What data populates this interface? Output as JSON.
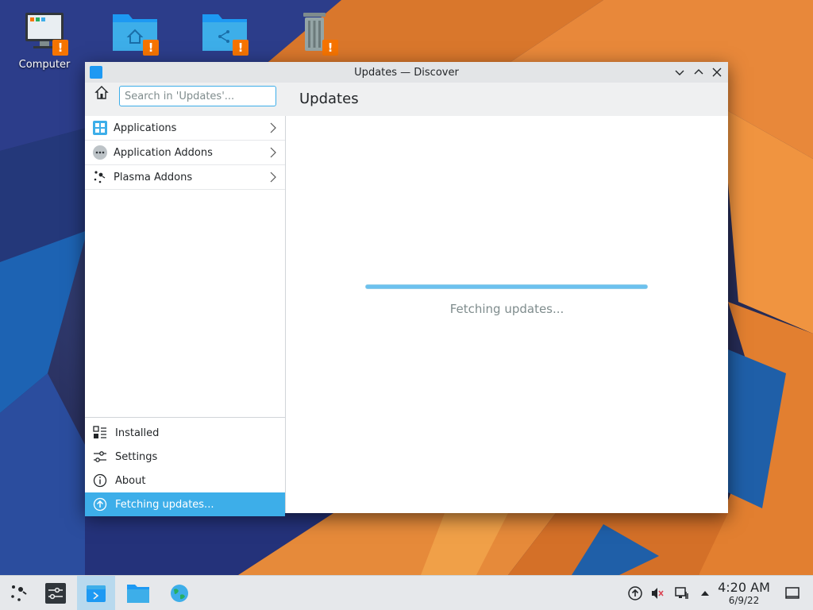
{
  "desktop": {
    "icons": [
      {
        "label": "Computer",
        "icon": "computer-icon"
      },
      {
        "label": "",
        "icon": "home-folder-icon"
      },
      {
        "label": "",
        "icon": "network-folder-icon"
      },
      {
        "label": "",
        "icon": "trash-icon"
      }
    ]
  },
  "window": {
    "title": "Updates — Discover",
    "search_placeholder": "Search in 'Updates'...",
    "page_title": "Updates",
    "categories": [
      {
        "label": "Applications",
        "icon": "applications-icon"
      },
      {
        "label": "Application Addons",
        "icon": "addons-icon"
      },
      {
        "label": "Plasma Addons",
        "icon": "plasma-icon"
      }
    ],
    "nav": [
      {
        "label": "Installed",
        "icon": "installed-icon"
      },
      {
        "label": "Settings",
        "icon": "settings-icon"
      },
      {
        "label": "About",
        "icon": "info-icon"
      },
      {
        "label": "Fetching updates...",
        "icon": "update-icon",
        "active": true
      }
    ],
    "progress_fraction": 1.0,
    "status_text": "Fetching updates..."
  },
  "taskbar": {
    "clock_time": "4:20 AM",
    "clock_date": "6/9/22"
  },
  "colors": {
    "accent": "#3daee9",
    "warning": "#f67400"
  }
}
